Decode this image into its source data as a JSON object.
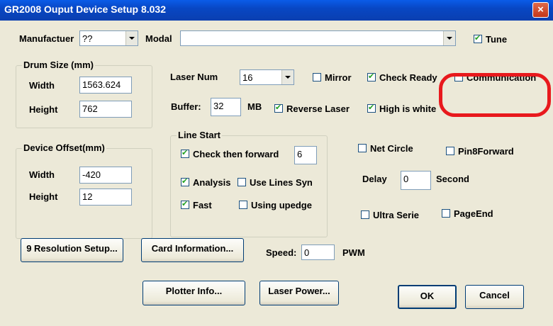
{
  "window": {
    "title": "GR2008 Ouput Device Setup 8.032",
    "close": "×"
  },
  "manufacturer": {
    "label": "Manufactuer",
    "value": "??"
  },
  "modal": {
    "label": "Modal",
    "value": ""
  },
  "tune": {
    "label": "Tune",
    "checked": true
  },
  "drum": {
    "legend": "Drum Size (mm)",
    "width_label": "Width",
    "width": "1563.624",
    "height_label": "Height",
    "height": "762"
  },
  "offset": {
    "legend": "Device Offset(mm)",
    "width_label": "Width",
    "width": "-420",
    "height_label": "Height",
    "height": "12"
  },
  "laser": {
    "label": "Laser Num",
    "value": "16"
  },
  "mirror": {
    "label": "Mirror",
    "checked": false
  },
  "check_ready": {
    "label": "Check Ready",
    "checked": true
  },
  "communication": {
    "label": "Communication",
    "checked": false
  },
  "buffer": {
    "label": "Buffer:",
    "value": "32",
    "unit": "MB"
  },
  "reverse_laser": {
    "label": "Reverse Laser",
    "checked": true
  },
  "high_white": {
    "label": "High is white",
    "checked": true
  },
  "line_start": {
    "legend": "Line Start",
    "check_forward": {
      "label": "Check then forward",
      "checked": true,
      "value": "6"
    },
    "analysis": {
      "label": "Analysis",
      "checked": true
    },
    "use_lines_syn": {
      "label": "Use Lines Syn",
      "checked": false
    },
    "fast": {
      "label": "Fast",
      "checked": true
    },
    "using_upedge": {
      "label": "Using upedge",
      "checked": false
    }
  },
  "net_circle": {
    "label": "Net Circle",
    "checked": false
  },
  "pin8forward": {
    "label": "Pin8Forward",
    "checked": false
  },
  "delay": {
    "label": "Delay",
    "value": "0",
    "unit": "Second"
  },
  "ultra_serie": {
    "label": "Ultra Serie",
    "checked": false
  },
  "page_end": {
    "label": "PageEnd",
    "checked": false
  },
  "buttons": {
    "resolution": "9 Resolution Setup...",
    "card_info": "Card Information...",
    "plotter_info": "Plotter Info...",
    "laser_power": "Laser Power...",
    "ok": "OK",
    "cancel": "Cancel"
  },
  "speed": {
    "label": "Speed:",
    "value": "0",
    "unit": "PWM"
  },
  "colors": {
    "titlebar": "#0a50d8",
    "dialog_bg": "#ece9d8",
    "annotation": "#e8191d"
  }
}
